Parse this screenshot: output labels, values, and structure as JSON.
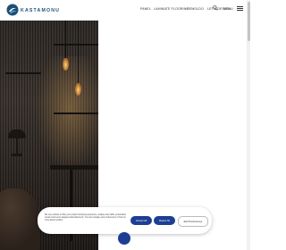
{
  "header": {
    "logo_text": "KASTAMONU",
    "nav": [
      "PANEL",
      "LAMINATE FLOORING",
      "REMOLDO",
      "LET'S DESIGN"
    ],
    "language": "EN",
    "menu_label": "MENU"
  },
  "cookie_banner": {
    "text": "We use cookies to offer you a better browsing experience, analyse site traffic, personalize content and serve targeted advertisements. You can manage your preferences or find out more about cookies.",
    "accept_label": "Accept All",
    "reject_label": "Reject All",
    "preferences_label": "Edit Preferences"
  },
  "colors": {
    "brand": "#1c4f76",
    "button": "#1c3f94"
  }
}
